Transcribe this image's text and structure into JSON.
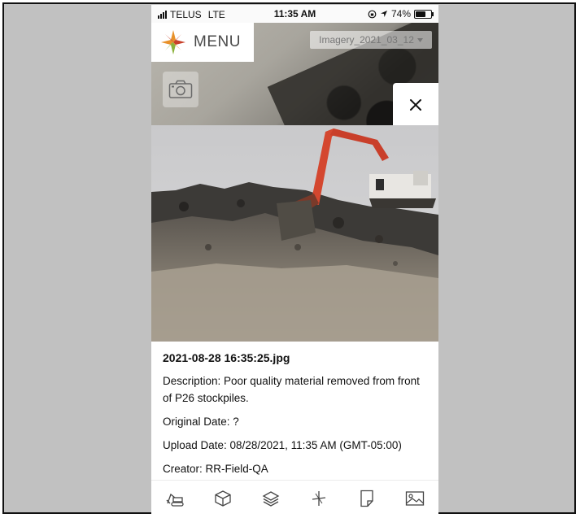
{
  "status_bar": {
    "carrier": "TELUS",
    "network": "LTE",
    "time": "11:35 AM",
    "battery_percent_label": "74%",
    "battery_level": 0.74
  },
  "header": {
    "menu_label": "MENU",
    "logo_icon": "compass-star-logo",
    "imagery_select_value": "Imagery_2021_03_12"
  },
  "map_controls": {
    "camera_icon": "camera-icon",
    "close_icon": "close-icon"
  },
  "photo": {
    "filename": "2021-08-28 16:35:25.jpg",
    "description": "Description: Poor quality material removed from front of P26 stockpiles.",
    "original_date": "Original Date: ?",
    "upload_date": "Upload Date: 08/28/2021, 11:35 AM (GMT-05:00)",
    "creator": "Creator: RR-Field-QA"
  },
  "toolbar": {
    "icons": [
      "excavator-icon",
      "cube-icon",
      "layers-icon",
      "measure-icon",
      "document-icon",
      "image-icon"
    ]
  },
  "colors": {
    "frame_background": "#c1c1c1",
    "logo_orange": "#e8912a",
    "logo_red": "#c8402a",
    "logo_green": "#8bb23a"
  }
}
